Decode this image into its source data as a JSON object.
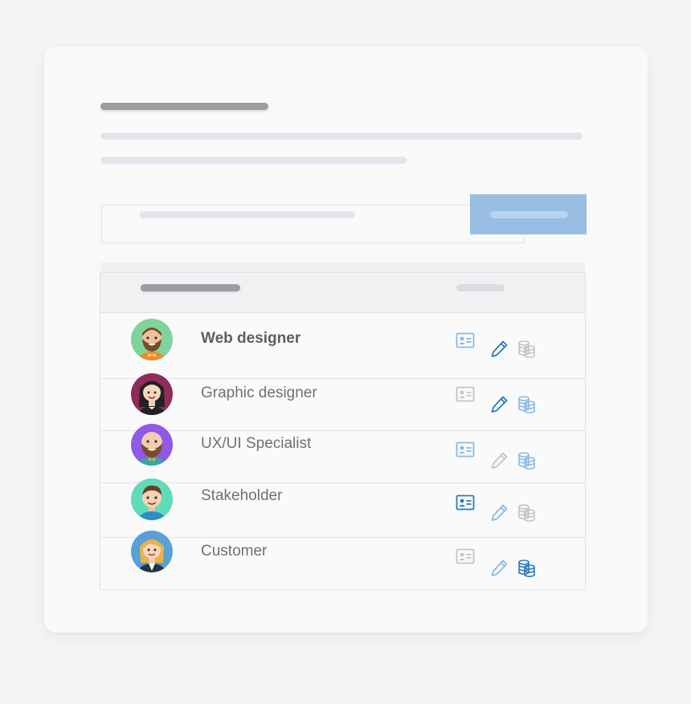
{
  "roles": [
    {
      "label": "Web designer",
      "avatar": "bearded-man-orange-bowtie-avatar",
      "avatar_bg": "#7fd49e",
      "selected": true,
      "card_state": "light",
      "pencil_state": "active",
      "coins_state": "off"
    },
    {
      "label": "Graphic designer",
      "avatar": "woman-black-hair-avatar",
      "avatar_bg": "#8f2c5c",
      "selected": false,
      "card_state": "off",
      "pencil_state": "active",
      "coins_state": "light"
    },
    {
      "label": "UX/UI Specialist",
      "avatar": "bald-bearded-man-avatar",
      "avatar_bg": "#8e5ae6",
      "selected": false,
      "card_state": "light",
      "pencil_state": "off",
      "coins_state": "light"
    },
    {
      "label": "Stakeholder",
      "avatar": "young-man-teal-shirt-avatar",
      "avatar_bg": "#5fdcb8",
      "selected": false,
      "card_state": "active",
      "pencil_state": "light",
      "coins_state": "off"
    },
    {
      "label": "Customer",
      "avatar": "blonde-woman-suit-avatar",
      "avatar_bg": "#5aa0d6",
      "selected": false,
      "card_state": "off",
      "pencil_state": "light",
      "coins_state": "active"
    }
  ],
  "icons": {
    "card": "contact-card-icon",
    "pencil": "pencil-icon",
    "coins": "coins-stack-icon"
  },
  "colors": {
    "active": "#2a78c2",
    "light": "#8ab9e6",
    "off": "#c4c4c7",
    "button": "#97bde3"
  }
}
